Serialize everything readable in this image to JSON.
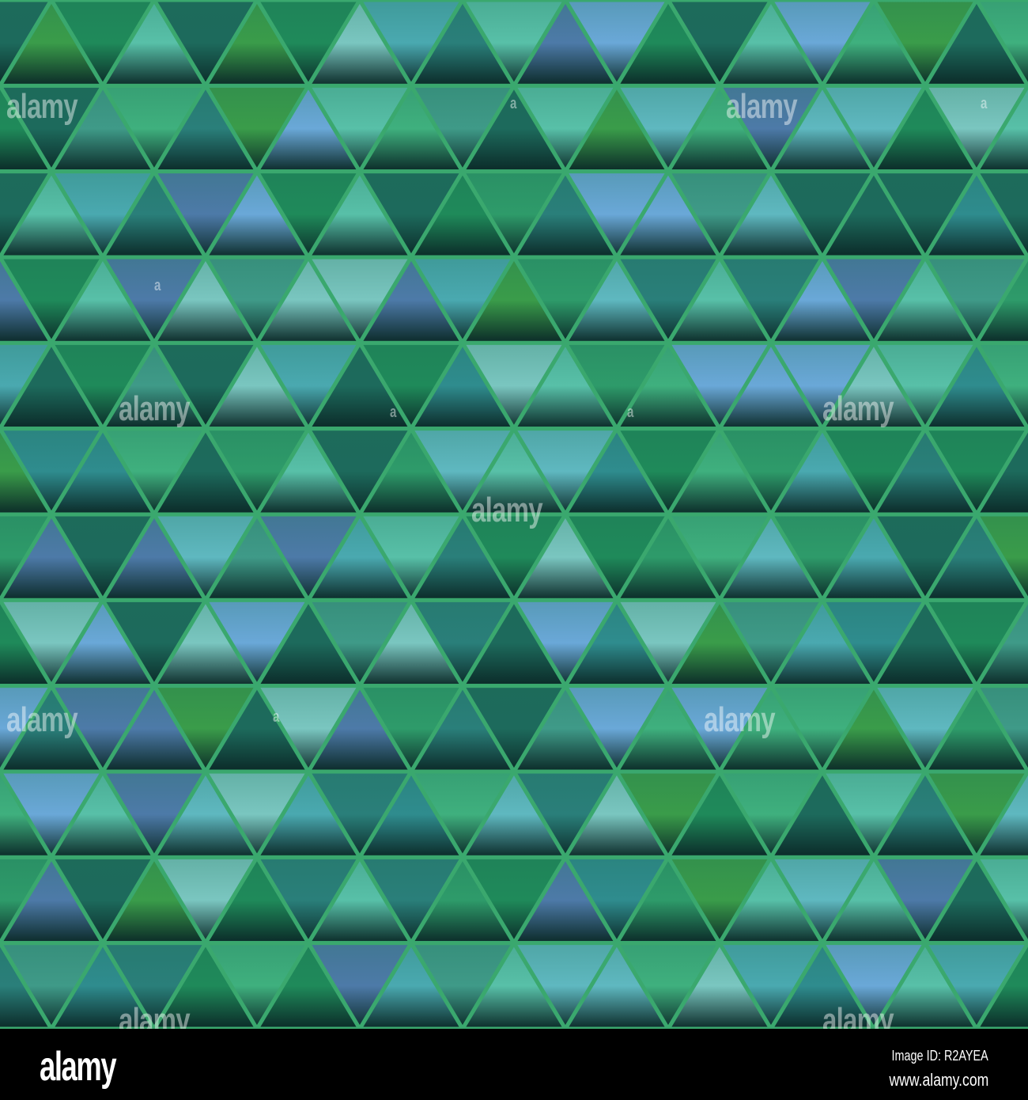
{
  "watermark": {
    "text": "alamy",
    "short": "a"
  },
  "footer": {
    "logo": "alamy",
    "image_id": "Image ID: R2AYEA",
    "website": "www.alamy.com"
  },
  "palette": [
    "#2e9b6a",
    "#1f8a5a",
    "#3fb07e",
    "#58c0a8",
    "#5fb8c0",
    "#2a7f7a",
    "#1d6a5c",
    "#3a9c4a",
    "#4aa9b0",
    "#6aa8d8",
    "#4d7aa8",
    "#2f8c8e",
    "#7ac6c0",
    "#3f9a88"
  ],
  "frame_color": "#3aa86e"
}
